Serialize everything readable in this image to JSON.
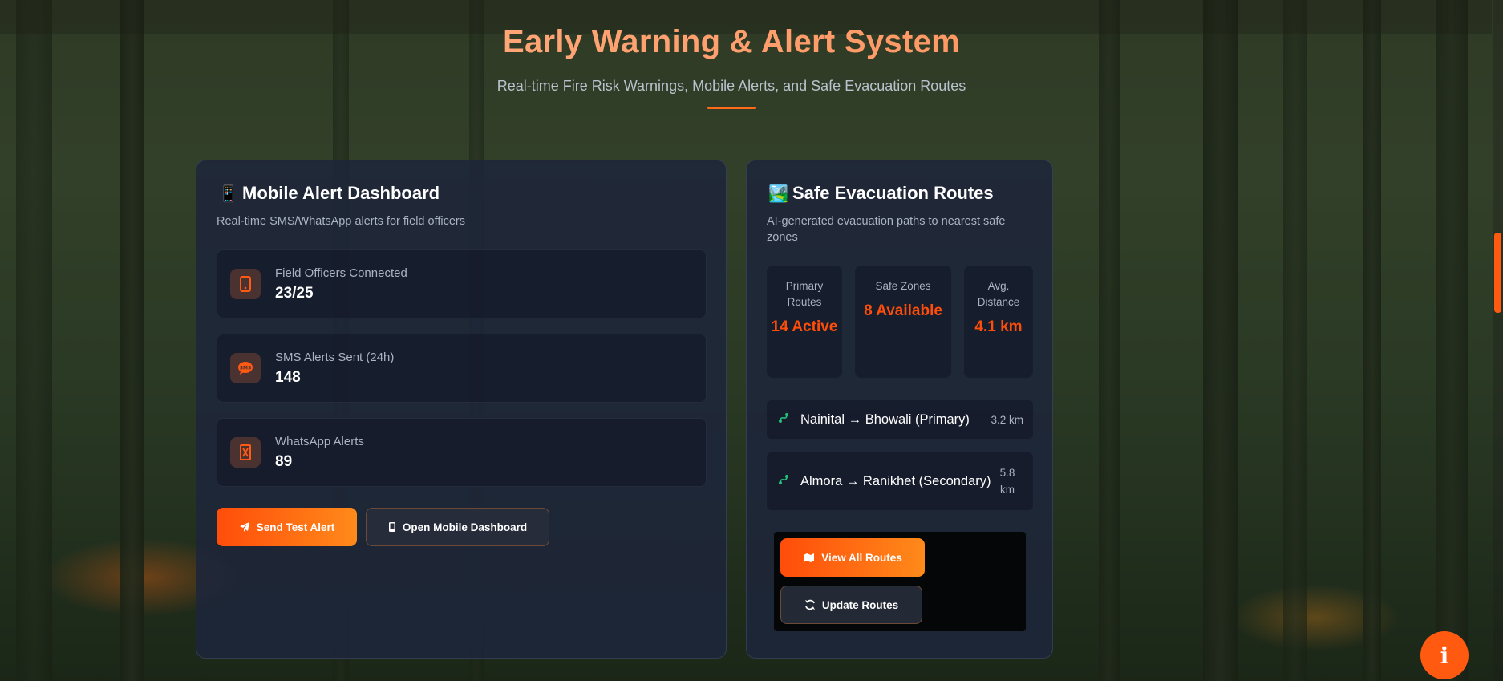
{
  "header": {
    "title": "Early Warning & Alert System",
    "subtitle": "Real-time Fire Risk Warnings, Mobile Alerts, and Safe Evacuation Routes"
  },
  "mobile_card": {
    "icon": "📱",
    "title": "Mobile Alert Dashboard",
    "description": "Real-time SMS/WhatsApp alerts for field officers",
    "stats": [
      {
        "icon": "📱",
        "icon_name": "mobile-phone-icon",
        "label": "Field Officers Connected",
        "value": "23/25"
      },
      {
        "icon": "💬",
        "icon_name": "sms-icon",
        "label": "SMS Alerts Sent (24h)",
        "value": "148"
      },
      {
        "icon": "⌛",
        "icon_name": "whatsapp-icon",
        "label": "WhatsApp Alerts",
        "value": "89"
      }
    ],
    "buttons": {
      "send_test_alert": "Send Test Alert",
      "open_mobile_dashboard": "Open Mobile Dashboard"
    }
  },
  "evac_card": {
    "icon": "🏞️",
    "title": "Safe Evacuation Routes",
    "description": "AI-generated evacuation paths to nearest safe zones",
    "stats": [
      {
        "label": "Primary Routes",
        "value": "14 Active"
      },
      {
        "label": "Safe Zones",
        "value": "8 Available"
      },
      {
        "label": "Avg. Distance",
        "value": "4.1 km"
      }
    ],
    "routes": [
      {
        "name": "Nainital → Bhowali (Primary)",
        "distance": "3.2 km"
      },
      {
        "name": "Almora → Ranikhet (Secondary)",
        "distance": "5.8 km"
      }
    ],
    "buttons": {
      "view_all_routes": "View All Routes",
      "update_routes": "Update Routes"
    }
  },
  "fab": {
    "label": "i"
  },
  "colors": {
    "accent": "#ff5a10",
    "title_gradient_start": "#ffb48a",
    "title_gradient_end": "#ff8a50",
    "route_icon": "#22c07a",
    "card_bg": "#1e263a"
  }
}
